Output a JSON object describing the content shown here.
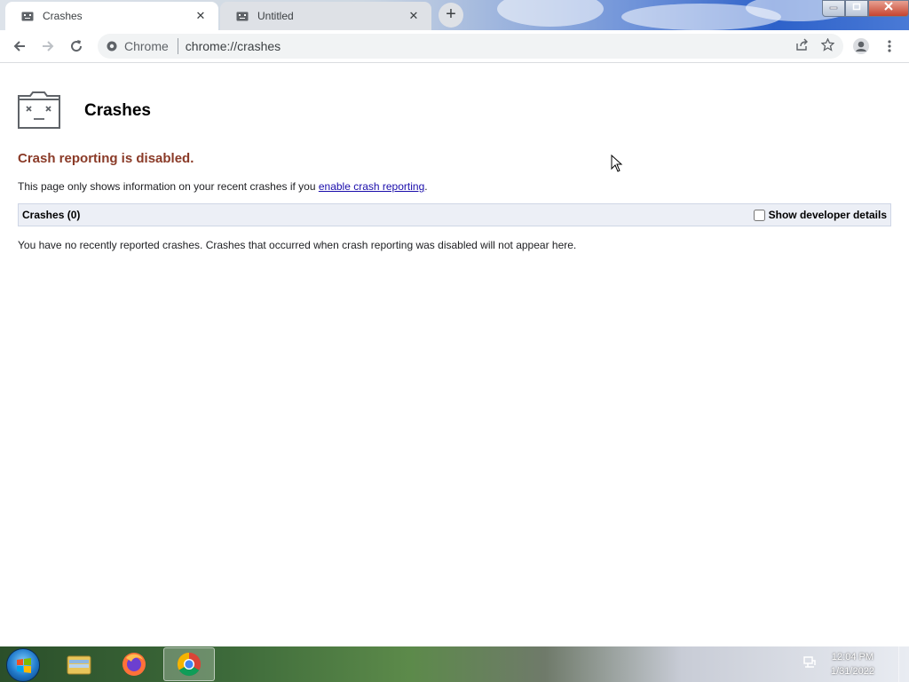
{
  "tabs": [
    {
      "title": "Crashes",
      "active": true
    },
    {
      "title": "Untitled",
      "active": false
    }
  ],
  "toolbar": {
    "site_name": "Chrome",
    "url": "chrome://crashes"
  },
  "page": {
    "title": "Crashes",
    "warning": "Crash reporting is disabled.",
    "info_prefix": "This page only shows information on your recent crashes if you ",
    "info_link": "enable crash reporting",
    "info_suffix": ".",
    "crash_count_label": "Crashes (0)",
    "show_dev_details_label": "Show developer details",
    "no_crashes_text": "You have no recently reported crashes. Crashes that occurred when crash reporting was disabled will not appear here."
  },
  "taskbar": {
    "apps": [
      "windows-explorer",
      "firefox",
      "chrome"
    ],
    "time": "12:04 PM",
    "date": "1/31/2022"
  },
  "colors": {
    "warning": "#8a3a27",
    "link": "#1a0dab"
  }
}
